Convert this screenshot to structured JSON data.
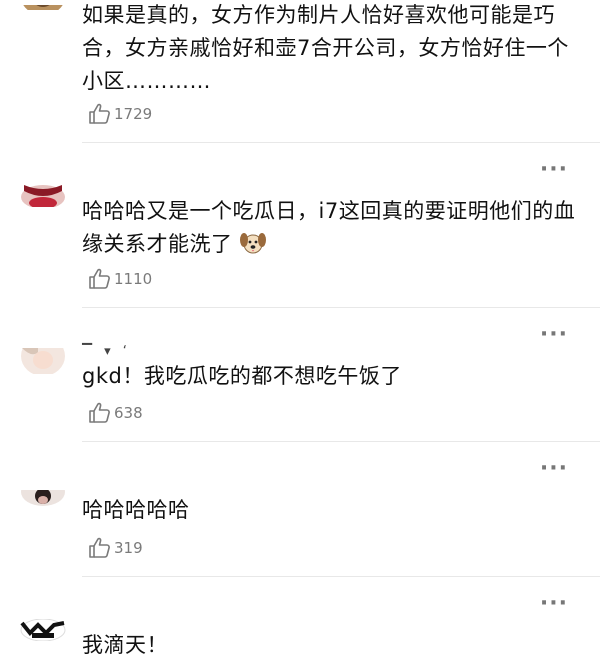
{
  "comments": [
    {
      "text": "如果是真的，女方作为制片人恰好喜欢他可能是巧合，女方亲戚恰好和壶7合开公司，女方恰好住一个小区…………",
      "likes": "1729",
      "more": "···"
    },
    {
      "text": "哈哈哈又是一个吃瓜日，i7这回真的要证明他们的血缘关系才能洗了",
      "emoji": "dog-face-emoji",
      "likes": "1110",
      "more": "···"
    },
    {
      "text": "gkd！我吃瓜吃的都不想吃午饭了",
      "likes": "638",
      "more": "···"
    },
    {
      "text": "哈哈哈哈哈",
      "likes": "319",
      "more": "···"
    },
    {
      "text": "我滴天！",
      "more": "···"
    }
  ],
  "icons": {
    "like": "thumbs-up-icon",
    "more": "more-dots-icon"
  },
  "colors": {
    "text": "#111111",
    "meta": "#7a7a7a",
    "divider": "#e8e8e8"
  }
}
